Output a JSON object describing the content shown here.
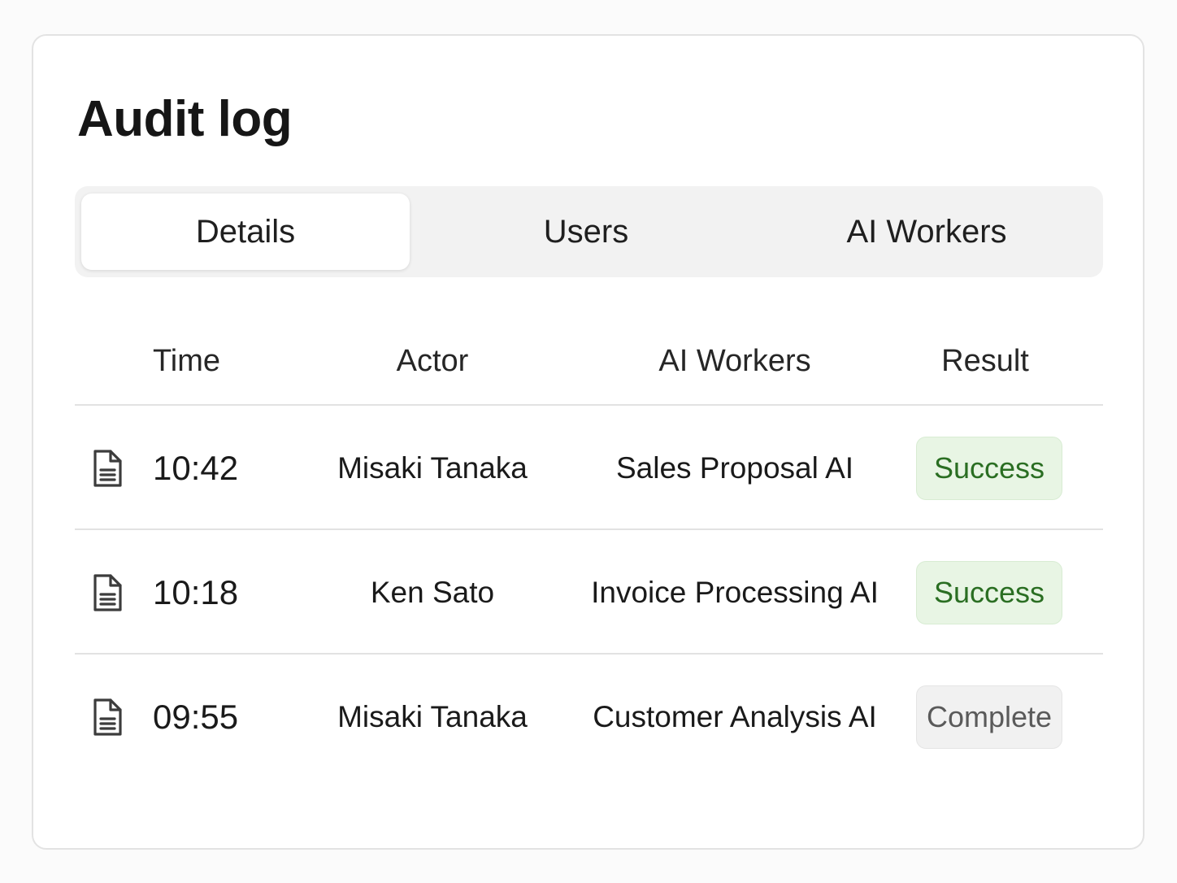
{
  "page": {
    "title": "Audit log"
  },
  "tabs": [
    {
      "label": "Details",
      "active": true
    },
    {
      "label": "Users",
      "active": false
    },
    {
      "label": "AI Workers",
      "active": false
    }
  ],
  "table": {
    "headers": [
      "Time",
      "Actor",
      "AI Workers",
      "Result"
    ],
    "rows": [
      {
        "icon": "document-icon",
        "time": "10:42",
        "actor": "Misaki Tanaka",
        "worker": "Sales Proposal AI",
        "result": "Success",
        "status": "success"
      },
      {
        "icon": "document-icon",
        "time": "10:18",
        "actor": "Ken Sato",
        "worker": "Invoice Processing AI",
        "result": "Success",
        "status": "success"
      },
      {
        "icon": "document-icon",
        "time": "09:55",
        "actor": "Misaki Tanaka",
        "worker": "Customer Analysis AI",
        "result": "Complete",
        "status": "complete"
      }
    ]
  },
  "colors": {
    "success_bg": "#e8f5e4",
    "success_text": "#2a6e22",
    "complete_bg": "#f1f1f1",
    "complete_text": "#5a5a5a"
  }
}
